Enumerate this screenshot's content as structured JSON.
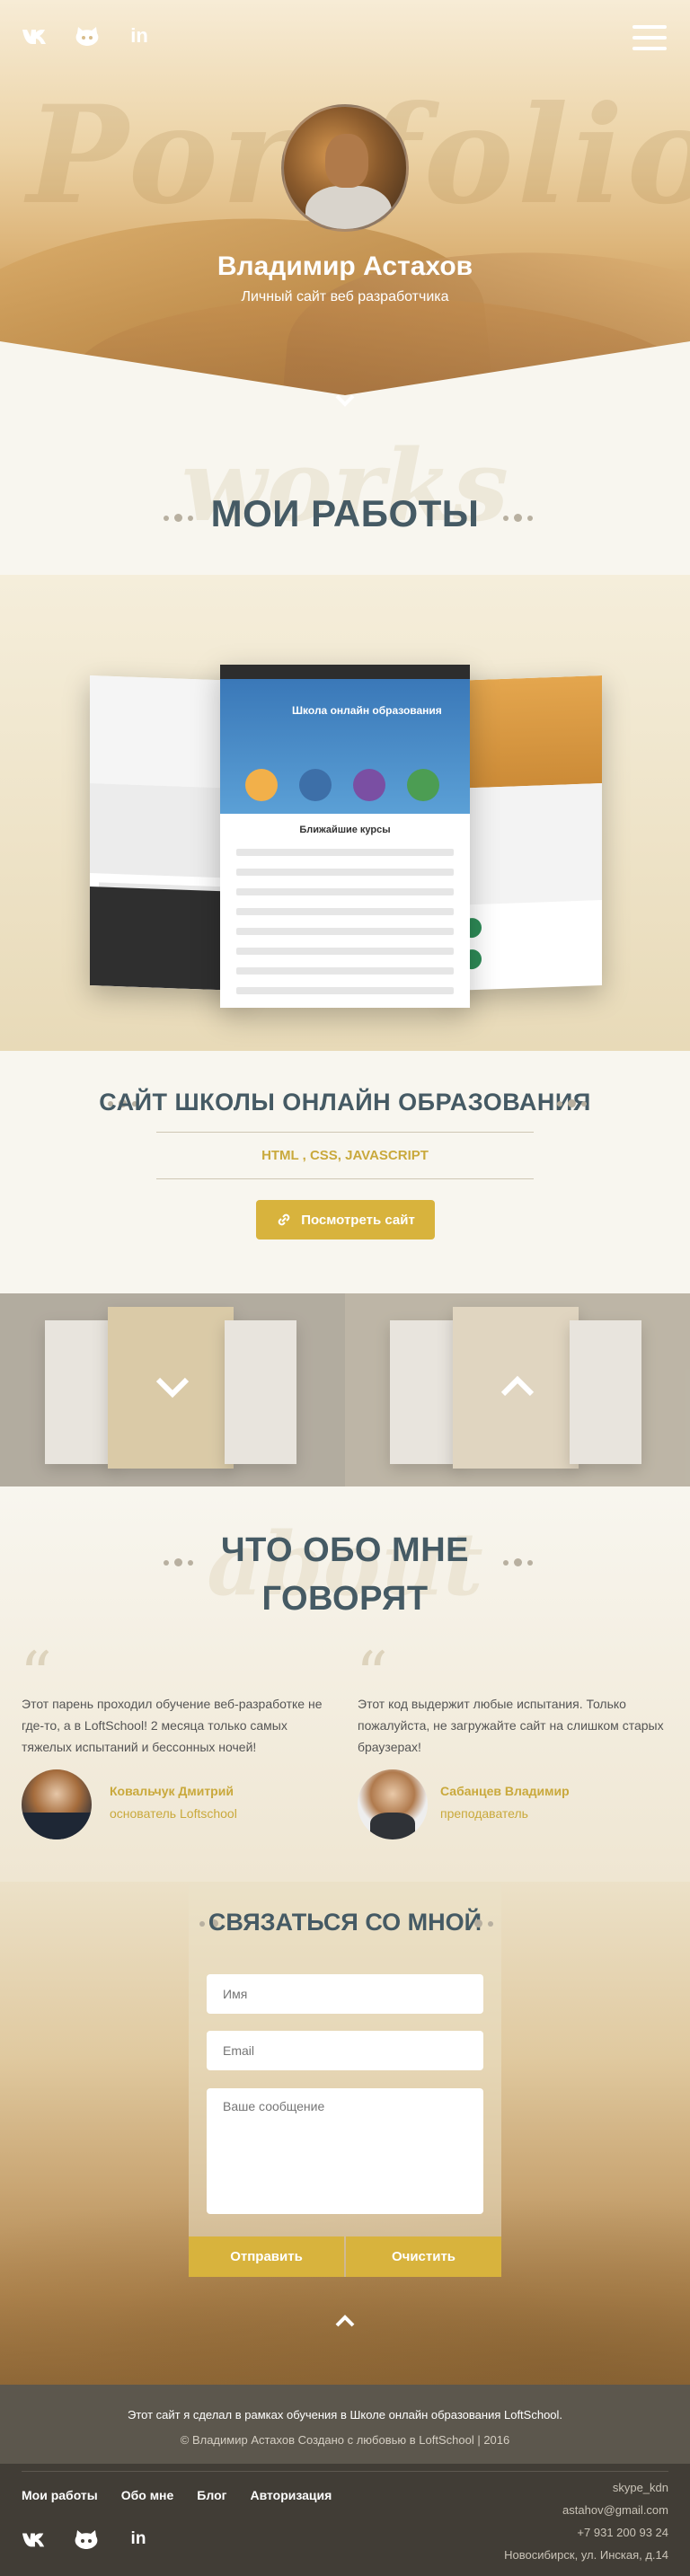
{
  "header": {
    "socials": [
      {
        "name": "vk",
        "label": "vk"
      },
      {
        "name": "github",
        "label": "github"
      },
      {
        "name": "linkedin",
        "label": "in"
      }
    ],
    "bg_word": "Portfolio",
    "name": "Владимир Астахов",
    "subtitle": "Личный сайт веб разработчика"
  },
  "works": {
    "bg_word": "works",
    "title": "МОИ РАБОТЫ",
    "mockup_title": "Школа онлайн образования",
    "mockup_courses_title": "Ближайшие курсы",
    "site_title": "САЙТ ШКОЛЫ ОНЛАЙН ОБРАЗОВАНИЯ",
    "techs": "HTML , CSS, JAVASCRIPT",
    "view_button": "Посмотреть сайт"
  },
  "testimonials": {
    "bg_word": "about",
    "title_line1": "ЧТО ОБО МНЕ",
    "title_line2": "ГОВОРЯТ",
    "items": [
      {
        "text": "Этот парень проходил обучение веб-разработке не где-то, а в LoftSchool! 2 месяца только самых тяжелых испытаний и бессонных ночей!",
        "name": "Ковальчук Дмитрий",
        "role": "основатель Loftschool"
      },
      {
        "text": "Этот код выдержит любые испытания. Только пожалуйста, не загружайте сайт на слишком старых браузерах!",
        "name": "Сабанцев Владимир",
        "role": "преподаватель"
      }
    ]
  },
  "contact": {
    "title": "СВЯЗАТЬСЯ СО МНОЙ",
    "name_placeholder": "Имя",
    "email_placeholder": "Email",
    "message_placeholder": "Ваше сообщение",
    "send_button": "Отправить",
    "clear_button": "Очистить"
  },
  "footer": {
    "line1": "Этот сайт я сделал в рамках обучения в Школе онлайн образования LoftSchool.",
    "line2": "© Владимир Астахов Создано с любовью в LoftSchool | 2016",
    "nav": [
      "Мои работы",
      "Обо мне",
      "Блог",
      "Авторизация"
    ],
    "skype": "skype_kdn",
    "email": "astahov@gmail.com",
    "phone": "+7 931 200 93 24",
    "address": "Новосибирск, ул. Инская, д.14"
  },
  "colors": {
    "accent": "#d8b33d",
    "title": "#455a64",
    "footer_dark": "#413d36"
  }
}
